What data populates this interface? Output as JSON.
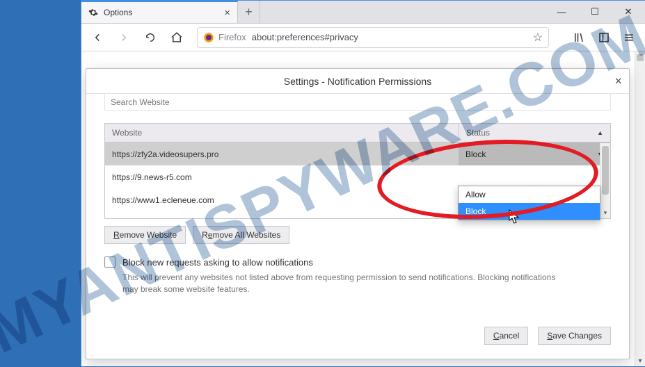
{
  "window": {
    "tab_title": "Options",
    "minimize": "—",
    "maximize": "☐",
    "close": "✕"
  },
  "nav": {
    "firefox_label": "Firefox",
    "url": "about:preferences#privacy"
  },
  "dialog": {
    "title": "Settings - Notification Permissions",
    "search_placeholder": "Search Website",
    "columns": {
      "website": "Website",
      "status": "Status"
    },
    "rows": [
      {
        "url": "https://zfy2a.videosupers.pro",
        "status": "Block",
        "selected": true
      },
      {
        "url": "https://9.news-r5.com",
        "status": ""
      },
      {
        "url": "https://www1.ecleneue.com",
        "status": ""
      }
    ],
    "dropdown": {
      "options": [
        "Allow",
        "Block"
      ],
      "highlighted": "Block"
    },
    "buttons": {
      "remove_website": "Remove Website",
      "remove_all": "Remove All Websites",
      "cancel": "Cancel",
      "save": "Save Changes"
    },
    "checkbox": {
      "label": "Block new requests asking to allow notifications",
      "desc": "This will prevent any websites not listed above from requesting permission to send notifications. Blocking notifications may break some website features."
    }
  },
  "watermark": "MYANTISPYWARE.COM"
}
